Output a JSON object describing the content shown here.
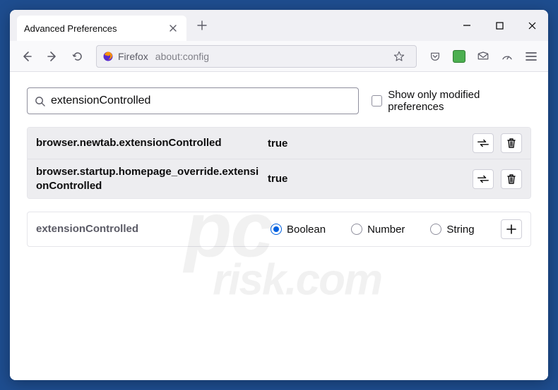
{
  "window": {
    "tab_title": "Advanced Preferences"
  },
  "toolbar": {
    "identity": "Firefox",
    "url": "about:config"
  },
  "config": {
    "search_value": "extensionControlled",
    "show_modified_label": "Show only modified preferences"
  },
  "prefs": [
    {
      "name": "browser.newtab.extensionControlled",
      "value": "true"
    },
    {
      "name": "browser.startup.homepage_override.extensionControlled",
      "value": "true"
    }
  ],
  "new_pref": {
    "name": "extensionControlled",
    "types": {
      "boolean": "Boolean",
      "number": "Number",
      "string": "String"
    }
  },
  "watermark": {
    "line1": "pc",
    "line2": "risk.com"
  }
}
